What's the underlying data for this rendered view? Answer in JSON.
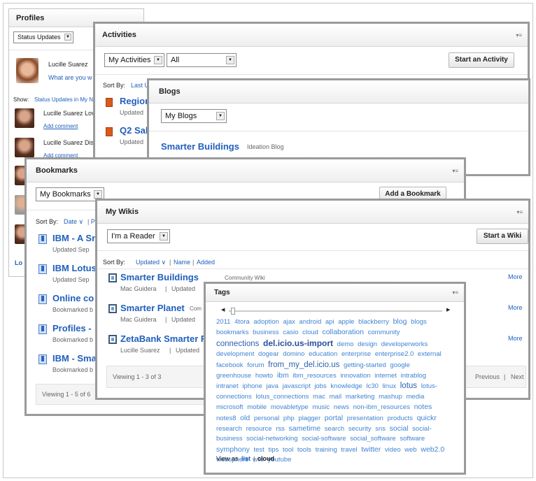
{
  "profiles": {
    "title": "Profiles",
    "status_select": "Status Updates",
    "user_name": "Lucille Suarez",
    "status_prompt": "What are you w",
    "show_label": "Show:",
    "show_value": "Status Updates in My N",
    "entries": [
      "Lucille Suarez Lov",
      "Lucille Suarez Dis"
    ],
    "add_comment": "Add comment",
    "footer_link": "Lo"
  },
  "activities": {
    "title": "Activities",
    "select1": "My Activities",
    "select2": "All",
    "button": "Start an Activity",
    "sort_label": "Sort By:",
    "sort_value": "Last U",
    "items": [
      {
        "title": "Region",
        "meta": "Updated"
      },
      {
        "title": "Q2 Sal",
        "meta": "Updated"
      }
    ]
  },
  "blogs": {
    "title": "Blogs",
    "select": "My Blogs",
    "entry_title": "Smarter Buildings",
    "entry_sub": "Ideation Blog"
  },
  "bookmarks": {
    "title": "Bookmarks",
    "select": "My Bookmarks",
    "button": "Add a Bookmark",
    "sort_label": "Sort By:",
    "sort_date": "Date",
    "sort_more": "P",
    "items": [
      {
        "title": "IBM - A Sn",
        "meta": "Updated Sep"
      },
      {
        "title": "IBM Lotus",
        "meta": "Updated Sep"
      },
      {
        "title": "Online co",
        "meta": "Bookmarked b"
      },
      {
        "title": "Profiles -",
        "meta": "Bookmarked b"
      },
      {
        "title": "IBM - Sma",
        "meta": "Bookmarked b"
      }
    ],
    "footer": "Viewing 1 - 5 of 6"
  },
  "wikis": {
    "title": "My Wikis",
    "select": "I'm a Reader",
    "button": "Start a Wiki",
    "sort_label": "Sort By:",
    "sort_updated": "Updated",
    "sort_name": "Name",
    "sort_added": "Added",
    "items": [
      {
        "title": "Smarter Buildings",
        "tag": "Community Wiki",
        "author": "Mac Guidera",
        "updated": "Updated",
        "more": "More"
      },
      {
        "title": "Smarter Planet",
        "tag": "Com",
        "author": "Mac Guidera",
        "updated": "Updated",
        "more": "More"
      },
      {
        "title": "ZetaBank Smarter F",
        "tag": "",
        "author": "Lucille Suarez",
        "updated": "Updated",
        "more": "More"
      }
    ],
    "footer": "Viewing 1 - 3 of 3",
    "prev": "Previous",
    "next": "Next"
  },
  "tags": {
    "title": "Tags",
    "view_as": "View as",
    "view_list": "list",
    "view_cloud": "cloud",
    "cloud": [
      {
        "t": "2011",
        "s": 1
      },
      {
        "t": "4tora",
        "s": 1
      },
      {
        "t": "adoption",
        "s": 1
      },
      {
        "t": "ajax",
        "s": 1
      },
      {
        "t": "android",
        "s": 1
      },
      {
        "t": "api",
        "s": 1
      },
      {
        "t": "apple",
        "s": 1
      },
      {
        "t": "blackberry",
        "s": 1
      },
      {
        "t": "blog",
        "s": 2
      },
      {
        "t": "blogs",
        "s": 1
      },
      {
        "t": "bookmarks",
        "s": 1
      },
      {
        "t": "business",
        "s": 1
      },
      {
        "t": "casio",
        "s": 1
      },
      {
        "t": "cloud",
        "s": 1
      },
      {
        "t": "collaboration",
        "s": 2
      },
      {
        "t": "community",
        "s": 1
      },
      {
        "t": "connections",
        "s": 3
      },
      {
        "t": "del.icio.us-import",
        "s": 4
      },
      {
        "t": "demo",
        "s": 1
      },
      {
        "t": "design",
        "s": 1
      },
      {
        "t": "developerworks",
        "s": 1
      },
      {
        "t": "development",
        "s": 1
      },
      {
        "t": "dogear",
        "s": 1
      },
      {
        "t": "domino",
        "s": 1
      },
      {
        "t": "education",
        "s": 1
      },
      {
        "t": "enterprise",
        "s": 1
      },
      {
        "t": "enterprise2.0",
        "s": 1
      },
      {
        "t": "external",
        "s": 1
      },
      {
        "t": "facebook",
        "s": 1
      },
      {
        "t": "forum",
        "s": 1
      },
      {
        "t": "from_my_del.icio.us",
        "s": 3
      },
      {
        "t": "getting-started",
        "s": 1
      },
      {
        "t": "google",
        "s": 1
      },
      {
        "t": "greenhouse",
        "s": 1
      },
      {
        "t": "howto",
        "s": 1
      },
      {
        "t": "ibm",
        "s": 2
      },
      {
        "t": "ibm_resources",
        "s": 1
      },
      {
        "t": "innovation",
        "s": 1
      },
      {
        "t": "internet",
        "s": 1
      },
      {
        "t": "intrablog",
        "s": 1
      },
      {
        "t": "intranet",
        "s": 1
      },
      {
        "t": "iphone",
        "s": 1
      },
      {
        "t": "java",
        "s": 1
      },
      {
        "t": "javascript",
        "s": 1
      },
      {
        "t": "jobs",
        "s": 1
      },
      {
        "t": "knowledge",
        "s": 1
      },
      {
        "t": "lc30",
        "s": 1
      },
      {
        "t": "linux",
        "s": 1
      },
      {
        "t": "lotus",
        "s": 3
      },
      {
        "t": "lotus-connections",
        "s": 1
      },
      {
        "t": "lotus_connections",
        "s": 1
      },
      {
        "t": "mac",
        "s": 1
      },
      {
        "t": "mail",
        "s": 1
      },
      {
        "t": "marketing",
        "s": 1
      },
      {
        "t": "mashup",
        "s": 1
      },
      {
        "t": "media",
        "s": 1
      },
      {
        "t": "microsoft",
        "s": 1
      },
      {
        "t": "mobile",
        "s": 1
      },
      {
        "t": "movabletype",
        "s": 1
      },
      {
        "t": "music",
        "s": 1
      },
      {
        "t": "news",
        "s": 1
      },
      {
        "t": "non-ibm_resources",
        "s": 1
      },
      {
        "t": "notes",
        "s": 2
      },
      {
        "t": "notes8",
        "s": 1
      },
      {
        "t": "old",
        "s": 2
      },
      {
        "t": "personal",
        "s": 1
      },
      {
        "t": "php",
        "s": 1
      },
      {
        "t": "plagger",
        "s": 1
      },
      {
        "t": "portal",
        "s": 2
      },
      {
        "t": "presentation",
        "s": 1
      },
      {
        "t": "products",
        "s": 1
      },
      {
        "t": "quickr",
        "s": 2
      },
      {
        "t": "research",
        "s": 1
      },
      {
        "t": "resource",
        "s": 1
      },
      {
        "t": "rss",
        "s": 1
      },
      {
        "t": "sametime",
        "s": 2
      },
      {
        "t": "search",
        "s": 1
      },
      {
        "t": "security",
        "s": 1
      },
      {
        "t": "sns",
        "s": 1
      },
      {
        "t": "social",
        "s": 2
      },
      {
        "t": "social-business",
        "s": 1
      },
      {
        "t": "social-networking",
        "s": 1
      },
      {
        "t": "social-software",
        "s": 1
      },
      {
        "t": "social_software",
        "s": 1
      },
      {
        "t": "software",
        "s": 1
      },
      {
        "t": "symphony",
        "s": 2
      },
      {
        "t": "test",
        "s": 1
      },
      {
        "t": "tips",
        "s": 1
      },
      {
        "t": "tool",
        "s": 1
      },
      {
        "t": "tools",
        "s": 1
      },
      {
        "t": "training",
        "s": 1
      },
      {
        "t": "travel",
        "s": 1
      },
      {
        "t": "twitter",
        "s": 2
      },
      {
        "t": "video",
        "s": 1
      },
      {
        "t": "web",
        "s": 1
      },
      {
        "t": "web2.0",
        "s": 2
      },
      {
        "t": "websphere",
        "s": 1
      },
      {
        "t": "wiki",
        "s": 1
      },
      {
        "t": "youtube",
        "s": 1
      }
    ]
  }
}
